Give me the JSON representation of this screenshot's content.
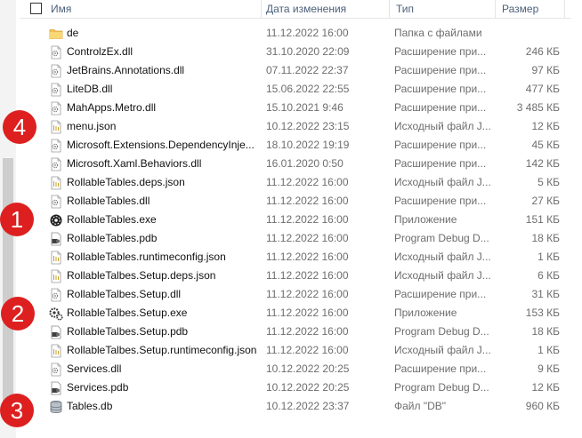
{
  "header": {
    "name": "Имя",
    "date": "Дата изменения",
    "type": "Тип",
    "size": "Размер"
  },
  "rows": [
    {
      "name": "de",
      "date": "11.12.2022 16:00",
      "type": "Папка с файлами",
      "size": "",
      "icon": "folder-icon"
    },
    {
      "name": "ControlzEx.dll",
      "date": "31.10.2020 22:09",
      "type": "Расширение при...",
      "size": "246 КБ",
      "icon": "dll-file-icon"
    },
    {
      "name": "JetBrains.Annotations.dll",
      "date": "07.11.2022 22:37",
      "type": "Расширение при...",
      "size": "97 КБ",
      "icon": "dll-file-icon"
    },
    {
      "name": "LiteDB.dll",
      "date": "15.06.2022 22:55",
      "type": "Расширение при...",
      "size": "477 КБ",
      "icon": "dll-file-icon"
    },
    {
      "name": "MahApps.Metro.dll",
      "date": "15.10.2021 9:46",
      "type": "Расширение при...",
      "size": "3 485 КБ",
      "icon": "dll-file-icon"
    },
    {
      "name": "menu.json",
      "date": "10.12.2022 23:15",
      "type": "Исходный файл J...",
      "size": "12 КБ",
      "icon": "json-file-icon"
    },
    {
      "name": "Microsoft.Extensions.DependencyInje...",
      "date": "18.10.2022 19:19",
      "type": "Расширение при...",
      "size": "45 КБ",
      "icon": "dll-file-icon"
    },
    {
      "name": "Microsoft.Xaml.Behaviors.dll",
      "date": "16.01.2020 0:50",
      "type": "Расширение при...",
      "size": "142 КБ",
      "icon": "dll-file-icon"
    },
    {
      "name": "RollableTables.deps.json",
      "date": "11.12.2022 16:00",
      "type": "Исходный файл J...",
      "size": "5 КБ",
      "icon": "json-file-icon"
    },
    {
      "name": "RollableTables.dll",
      "date": "11.12.2022 16:00",
      "type": "Расширение при...",
      "size": "27 КБ",
      "icon": "dll-file-icon"
    },
    {
      "name": "RollableTables.exe",
      "date": "11.12.2022 16:00",
      "type": "Приложение",
      "size": "151 КБ",
      "icon": "exe-app-icon"
    },
    {
      "name": "RollableTables.pdb",
      "date": "11.12.2022 16:00",
      "type": "Program Debug D...",
      "size": "18 КБ",
      "icon": "pdb-file-icon"
    },
    {
      "name": "RollableTables.runtimeconfig.json",
      "date": "11.12.2022 16:00",
      "type": "Исходный файл J...",
      "size": "1 КБ",
      "icon": "json-file-icon"
    },
    {
      "name": "RollableTalbes.Setup.deps.json",
      "date": "11.12.2022 16:00",
      "type": "Исходный файл J...",
      "size": "6 КБ",
      "icon": "json-file-icon"
    },
    {
      "name": "RollableTalbes.Setup.dll",
      "date": "11.12.2022 16:00",
      "type": "Расширение при...",
      "size": "31 КБ",
      "icon": "dll-file-icon"
    },
    {
      "name": "RollableTalbes.Setup.exe",
      "date": "11.12.2022 16:00",
      "type": "Приложение",
      "size": "153 КБ",
      "icon": "setup-exe-icon"
    },
    {
      "name": "RollableTalbes.Setup.pdb",
      "date": "11.12.2022 16:00",
      "type": "Program Debug D...",
      "size": "18 КБ",
      "icon": "pdb-file-icon"
    },
    {
      "name": "RollableTalbes.Setup.runtimeconfig.json",
      "date": "11.12.2022 16:00",
      "type": "Исходный файл J...",
      "size": "1 КБ",
      "icon": "json-file-icon"
    },
    {
      "name": "Services.dll",
      "date": "10.12.2022 20:25",
      "type": "Расширение при...",
      "size": "9 КБ",
      "icon": "dll-file-icon"
    },
    {
      "name": "Services.pdb",
      "date": "10.12.2022 20:25",
      "type": "Program Debug D...",
      "size": "12 КБ",
      "icon": "pdb-file-icon"
    },
    {
      "name": "Tables.db",
      "date": "10.12.2022 23:37",
      "type": "Файл \"DB\"",
      "size": "960 КБ",
      "icon": "database-icon"
    }
  ],
  "badges": [
    "4",
    "1",
    "2",
    "3"
  ],
  "colors": {
    "badge": "#dd1f1f",
    "header_text": "#4c607a",
    "folder": "#f2c14e"
  }
}
